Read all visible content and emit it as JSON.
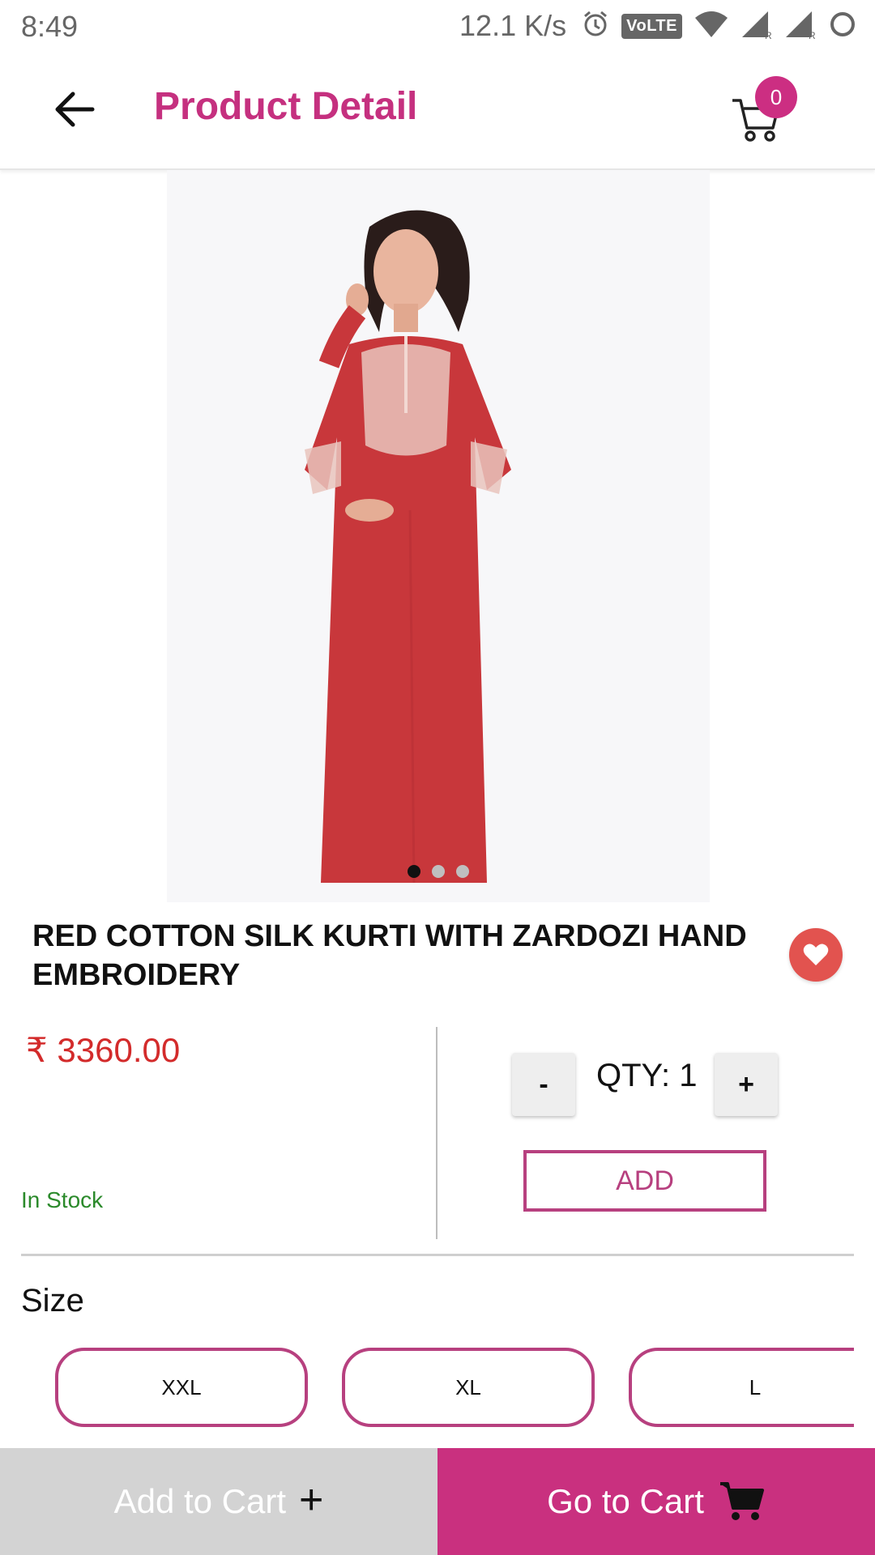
{
  "status_bar": {
    "time": "8:49",
    "network_speed": "12.1 K/s",
    "volte_label": "VoLTE",
    "icons": [
      "alarm-icon",
      "volte-icon",
      "wifi-icon",
      "signal-icon",
      "signal-icon",
      "sync-icon"
    ]
  },
  "header": {
    "title": "Product Detail",
    "back_icon": "arrow-left-icon",
    "cart_icon": "cart-icon",
    "cart_count": "0"
  },
  "product": {
    "image_alt": "woman-in-red-kurti",
    "carousel": {
      "total": 3,
      "active_index": 0
    },
    "title": "RED COTTON SILK KURTI WITH ZARDOZI HAND EMBROIDERY",
    "price": "₹ 3360.00",
    "stock_status": "In Stock",
    "favorite_icon": "heart-icon"
  },
  "quantity": {
    "minus_label": "-",
    "label": "QTY: 1",
    "plus_label": "+",
    "add_label": "ADD"
  },
  "size": {
    "heading": "Size",
    "options": [
      "XXL",
      "XL",
      "L"
    ]
  },
  "bottom_bar": {
    "add_to_cart": "Add to Cart",
    "add_icon": "plus-icon",
    "go_to_cart": "Go to Cart",
    "go_icon": "cart-icon"
  },
  "colors": {
    "brand": "#c9307f",
    "price": "#d32b2b",
    "in_stock": "#2b8a2b",
    "favorite": "#e2534f",
    "add_to_cart_bg": "#d3d3d3"
  }
}
